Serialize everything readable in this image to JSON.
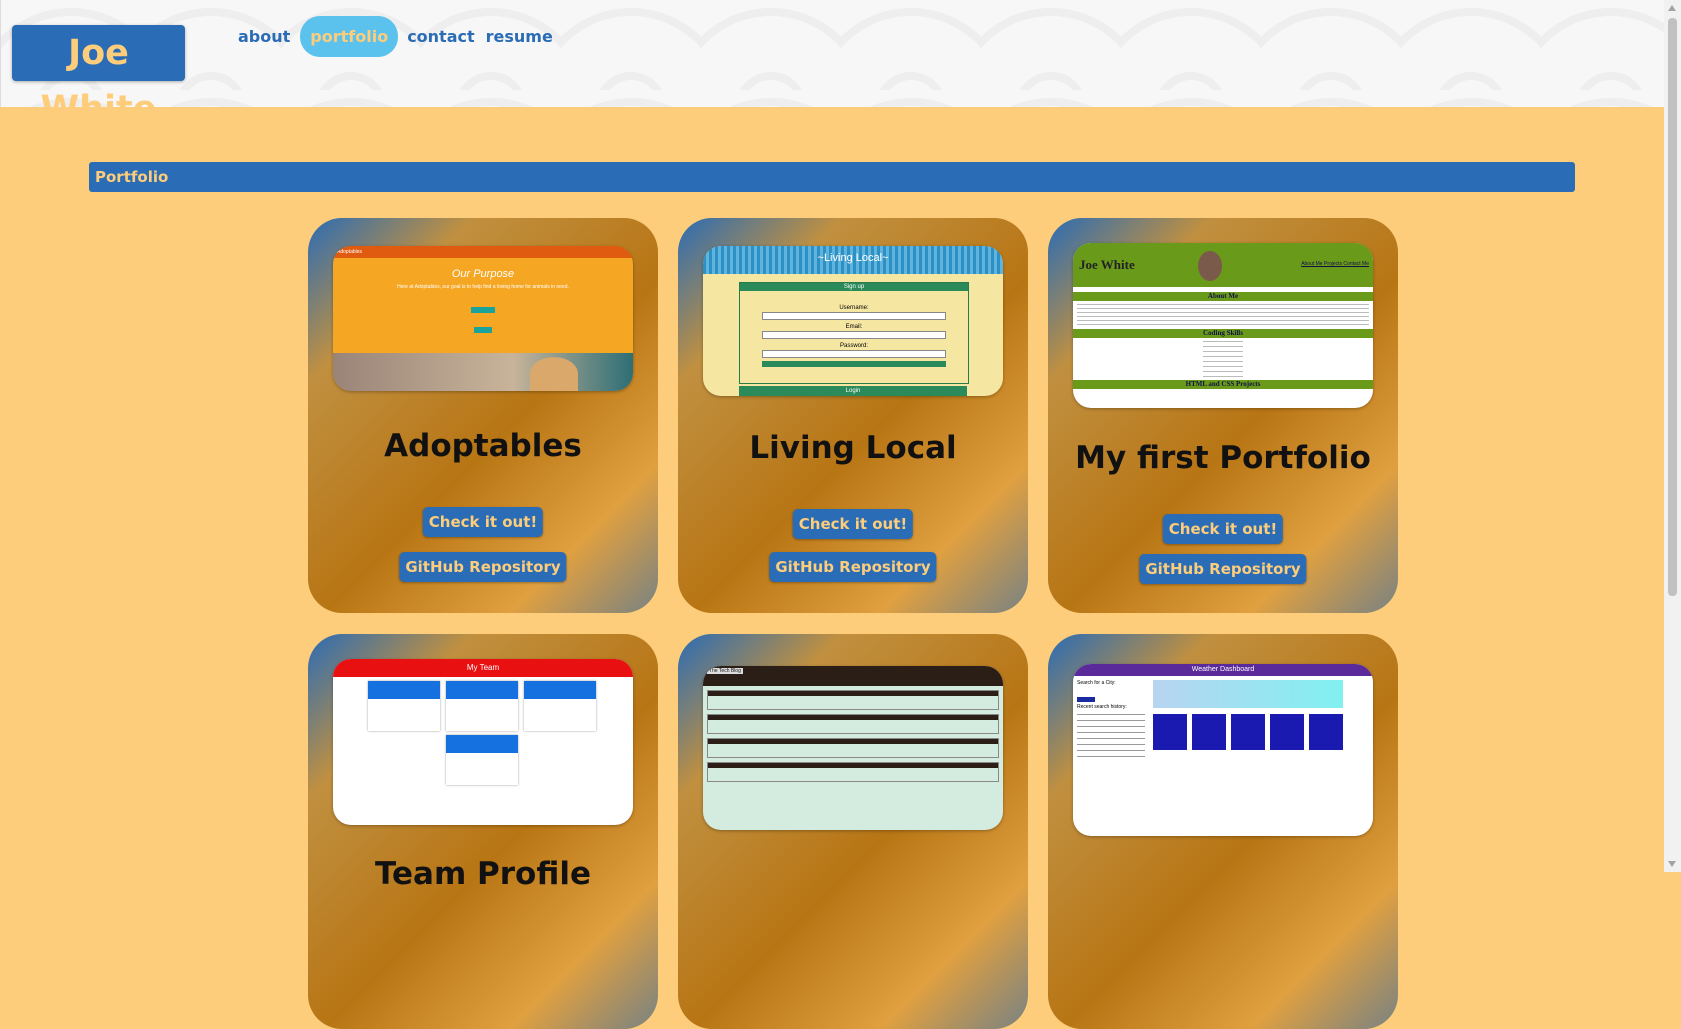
{
  "header": {
    "logo": "Joe White"
  },
  "nav": [
    {
      "label": "about",
      "active": false
    },
    {
      "label": "portfolio",
      "active": true
    },
    {
      "label": "contact",
      "active": false
    },
    {
      "label": "resume",
      "active": false
    }
  ],
  "section_title": "Portfolio",
  "cards": [
    {
      "title": "Adoptables",
      "live_label": "Check it out!",
      "repo_label": "GitHub Repository",
      "shot": {
        "brand": "Adoptables",
        "heading": "Our Purpose",
        "text": "Here at Adoptables, our goal is to help find a loving home for animals in need."
      }
    },
    {
      "title": "Living Local",
      "live_label": "Check it out!",
      "repo_label": "GitHub Repository",
      "shot": {
        "banner": "~Living Local~",
        "signup": "Sign up",
        "username": "Username:",
        "email": "Email:",
        "password": "Password:",
        "login": "Login"
      }
    },
    {
      "title": "My first Portfolio",
      "live_label": "Check it out!",
      "repo_label": "GitHub Repository",
      "shot": {
        "name": "Joe White",
        "links": "About Me  Projects  Contact Me",
        "about": "About Me",
        "skills": "Coding Skills",
        "projects": "HTML and CSS Projects"
      }
    },
    {
      "title": "Team Profile",
      "shot": {
        "banner": "My Team"
      }
    },
    {
      "title": "",
      "shot": {
        "banner": "The Tech Blog"
      }
    },
    {
      "title": "",
      "shot": {
        "banner": "Weather Dashboard",
        "search": "Search for a City:",
        "recent": "Recent search history:"
      }
    }
  ]
}
